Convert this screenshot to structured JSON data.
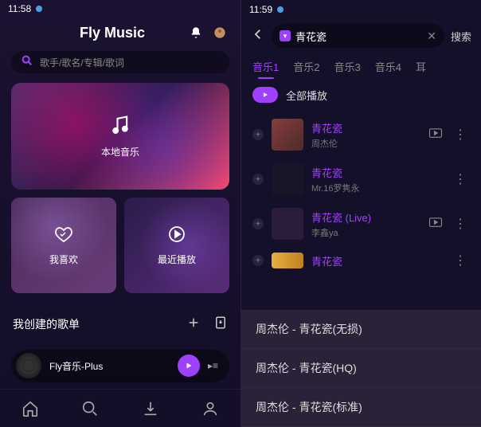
{
  "left": {
    "status": {
      "time": "11:58"
    },
    "header": {
      "title": "Fly Music"
    },
    "search": {
      "placeholder": "歌手/歌名/专辑/歌词"
    },
    "cards": {
      "local": "本地音乐",
      "like": "我喜欢",
      "recent": "最近播放"
    },
    "playlist": {
      "title": "我创建的歌单"
    },
    "nowPlaying": {
      "title": "Fly音乐-Plus"
    }
  },
  "right": {
    "status": {
      "time": "11:59"
    },
    "search": {
      "query": "青花瓷",
      "button": "搜索"
    },
    "tabs": [
      "音乐1",
      "音乐2",
      "音乐3",
      "音乐4",
      "耳"
    ],
    "playAll": "全部播放",
    "songs": [
      {
        "title": "青花瓷",
        "artist": "周杰伦",
        "art": "a1",
        "mv": true
      },
      {
        "title": "青花瓷",
        "artist": "Mr.16罗隽永",
        "art": "a2",
        "mv": false
      },
      {
        "title": "青花瓷 (Live)",
        "artist": "李鑫ya",
        "art": "a3",
        "mv": true
      },
      {
        "title": "青花瓷",
        "artist": "",
        "art": "a4",
        "mv": false
      }
    ],
    "suggestions": [
      "周杰伦 - 青花瓷(无损)",
      "周杰伦 - 青花瓷(HQ)",
      "周杰伦 - 青花瓷(标准)"
    ]
  }
}
